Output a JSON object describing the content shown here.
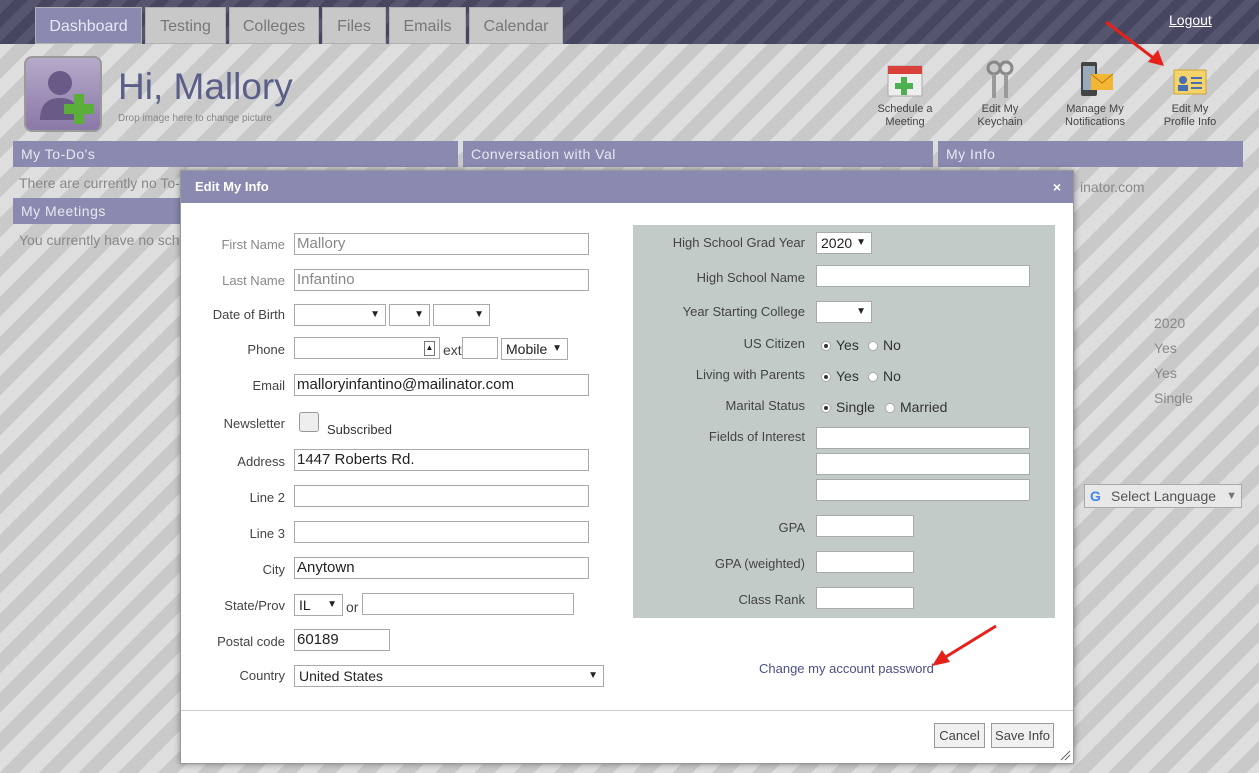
{
  "nav": {
    "tabs": [
      "Dashboard",
      "Testing",
      "Colleges",
      "Files",
      "Emails",
      "Calendar"
    ],
    "logout": "Logout"
  },
  "header": {
    "greeting": "Hi, Mallory",
    "drop_hint": "Drop image here to change picture",
    "actions": [
      {
        "line1": "Schedule a",
        "line2": "Meeting",
        "icon": "calendar-plus-icon"
      },
      {
        "line1": "Edit My",
        "line2": "Keychain",
        "icon": "keys-icon"
      },
      {
        "line1": "Manage My",
        "line2": "Notifications",
        "icon": "phone-mail-icon"
      },
      {
        "line1": "Edit My",
        "line2": "Profile Info",
        "icon": "id-card-icon"
      }
    ]
  },
  "sections": {
    "todos": "My To-Do's",
    "todos_text": "There are currently no To-",
    "meetings": "My Meetings",
    "meetings_text": "You currently have no sche",
    "conversation": "Conversation with Val",
    "myinfo": "My Info",
    "myinfo_email": "inator.com",
    "myinfo_values": [
      "2020",
      "Yes",
      "Yes",
      "Single"
    ]
  },
  "translate": "Select Language",
  "modal": {
    "title": "Edit My Info",
    "close": "×",
    "first_name_label": "First Name",
    "first_name": "Mallory",
    "last_name_label": "Last Name",
    "last_name": "Infantino",
    "dob_label": "Date of Birth",
    "phone_label": "Phone",
    "ext_label": "ext",
    "phone_type": "Mobile",
    "email_label": "Email",
    "email": "malloryinfantino@mailinator.com",
    "newsletter_label": "Newsletter",
    "subscribed": "Subscribed",
    "address_label": "Address",
    "address": "1447 Roberts Rd.",
    "line2_label": "Line 2",
    "line3_label": "Line 3",
    "city_label": "City",
    "city": "Anytown",
    "state_label": "State/Prov",
    "state": "IL",
    "or": "or",
    "postal_label": "Postal code",
    "postal": "60189",
    "country_label": "Country",
    "country": "United States",
    "grad_year_label": "High School Grad Year",
    "grad_year": "2020",
    "hs_name_label": "High School Name",
    "year_college_label": "Year Starting College",
    "citizen_label": "US Citizen",
    "parents_label": "Living with Parents",
    "marital_label": "Marital Status",
    "yes": "Yes",
    "no": "No",
    "single": "Single",
    "married": "Married",
    "fields_label": "Fields of Interest",
    "gpa_label": "GPA",
    "gpa_w_label": "GPA (weighted)",
    "rank_label": "Class Rank",
    "change_password": "Change my account password",
    "cancel": "Cancel",
    "save": "Save Info"
  },
  "colors": {
    "accent": "#8a8ab0",
    "annotation": "#e8201a"
  }
}
